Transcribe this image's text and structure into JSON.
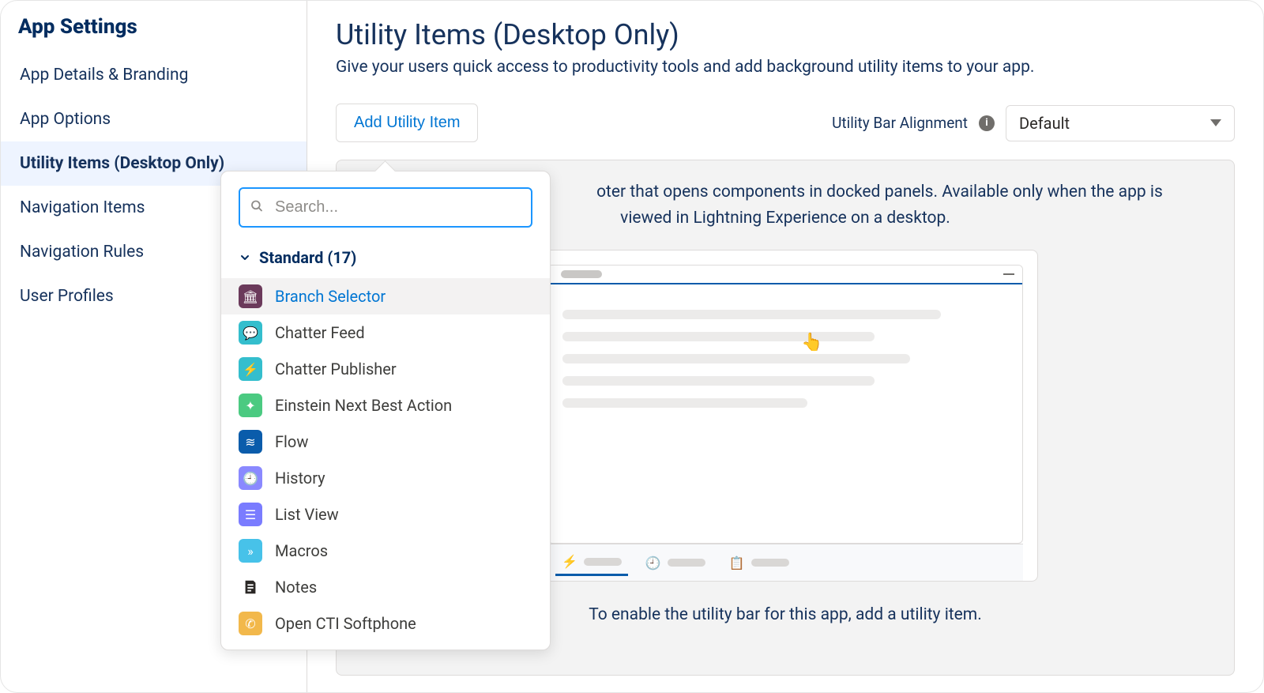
{
  "sidebar": {
    "title": "App Settings",
    "items": [
      {
        "label": "App Details & Branding",
        "active": false
      },
      {
        "label": "App Options",
        "active": false
      },
      {
        "label": "Utility Items (Desktop Only)",
        "active": true
      },
      {
        "label": "Navigation Items",
        "active": false
      },
      {
        "label": "Navigation Rules",
        "active": false
      },
      {
        "label": "User Profiles",
        "active": false
      }
    ]
  },
  "page": {
    "title": "Utility Items (Desktop Only)",
    "subtitle": "Give your users quick access to productivity tools and add background utility items to your app."
  },
  "toolbar": {
    "add_label": "Add Utility Item",
    "alignment_label": "Utility Bar Alignment",
    "alignment_value": "Default"
  },
  "info_panel": {
    "description_suffix": "oter that opens components in docked panels. Available only when the app is viewed in Lightning Experience on a desktop.",
    "enable_text": "To enable the utility bar for this app, add a utility item."
  },
  "dropdown": {
    "search_placeholder": "Search...",
    "section_label": "Standard (17)",
    "items": [
      {
        "label": "Branch Selector",
        "icon": "building-columns",
        "color": "#6b3a5b",
        "hover": true
      },
      {
        "label": "Chatter Feed",
        "icon": "speech",
        "color": "#34becd"
      },
      {
        "label": "Chatter Publisher",
        "icon": "bolt",
        "color": "#34becd"
      },
      {
        "label": "Einstein Next Best Action",
        "icon": "sparkle",
        "color": "#4bca81"
      },
      {
        "label": "Flow",
        "icon": "waves",
        "color": "#0a5cab"
      },
      {
        "label": "History",
        "icon": "clock",
        "color": "#8a89ff"
      },
      {
        "label": "List View",
        "icon": "list",
        "color": "#7a7cff"
      },
      {
        "label": "Macros",
        "icon": "chevrons",
        "color": "#47c2e9"
      },
      {
        "label": "Notes",
        "icon": "note",
        "color": "#2b2826",
        "dark": true
      },
      {
        "label": "Open CTI Softphone",
        "icon": "phone",
        "color": "#f2b84b"
      }
    ]
  }
}
